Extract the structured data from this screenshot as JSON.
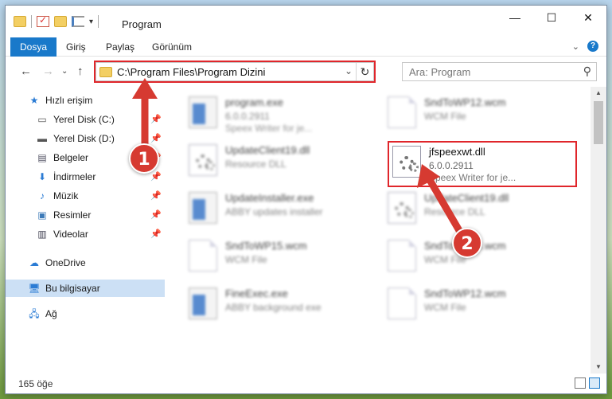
{
  "window": {
    "title": "Program",
    "controls": {
      "minimize": "—",
      "maximize": "☐",
      "close": "✕"
    }
  },
  "ribbon": {
    "tabs": [
      "Dosya",
      "Giriş",
      "Paylaş",
      "Görünüm"
    ],
    "expand_icon": "chevron-down",
    "help_label": "?"
  },
  "address": {
    "path": "C:\\Program Files\\Program Dizini",
    "search_placeholder": "Ara: Program"
  },
  "sidebar": {
    "items": [
      {
        "label": "Hızlı erişim",
        "icon": "star-icon"
      },
      {
        "label": "Yerel Disk (C:)",
        "icon": "drive-icon",
        "pinned": true
      },
      {
        "label": "Yerel Disk (D:)",
        "icon": "drive-icon",
        "pinned": true
      },
      {
        "label": "Belgeler",
        "icon": "documents-icon",
        "pinned": true
      },
      {
        "label": "İndirmeler",
        "icon": "downloads-icon",
        "pinned": true
      },
      {
        "label": "Müzik",
        "icon": "music-icon",
        "pinned": true
      },
      {
        "label": "Resimler",
        "icon": "pictures-icon",
        "pinned": true
      },
      {
        "label": "Videolar",
        "icon": "videos-icon",
        "pinned": true
      },
      {
        "label": "OneDrive",
        "icon": "cloud-icon"
      },
      {
        "label": "Bu bilgisayar",
        "icon": "computer-icon",
        "selected": true
      },
      {
        "label": "Ağ",
        "icon": "network-icon"
      }
    ]
  },
  "files": [
    {
      "name": "program.exe",
      "line2": "6.0.0.2911",
      "line3": "Speex Writer for je...",
      "type": "exe",
      "blurred": true
    },
    {
      "name": "SndToWP12.wcm",
      "line2": "WCM File",
      "line3": "",
      "type": "doc",
      "blurred": true
    },
    {
      "name": "UpdateClient19.dll",
      "line2": "Resource DLL",
      "line3": "",
      "type": "dll",
      "blurred": true
    },
    {
      "name": "jfspeexwt.dll",
      "line2": "6.0.0.2911",
      "line3": "Speex Writer for je...",
      "type": "dll",
      "blurred": false
    },
    {
      "name": "UpdateInstaller.exe",
      "line2": "ABBY updates installer",
      "line3": "",
      "type": "exe",
      "blurred": true
    },
    {
      "name": "UpdateClient19.dll",
      "line2": "Resource DLL",
      "line3": "",
      "type": "dll",
      "blurred": true
    },
    {
      "name": "SndToWP15.wcm",
      "line2": "WCM File",
      "line3": "",
      "type": "doc",
      "blurred": true
    },
    {
      "name": "SndToWP15.wcm",
      "line2": "WCM File",
      "line3": "",
      "type": "doc",
      "blurred": true
    },
    {
      "name": "FineExec.exe",
      "line2": "ABBY background exe",
      "line3": "",
      "type": "exe",
      "blurred": true
    },
    {
      "name": "SndToWP12.wcm",
      "line2": "WCM File",
      "line3": "",
      "type": "doc",
      "blurred": true
    }
  ],
  "status": {
    "count": "165 öğe"
  },
  "annotations": {
    "badge1": "1",
    "badge2": "2",
    "color": "#d63a31"
  }
}
